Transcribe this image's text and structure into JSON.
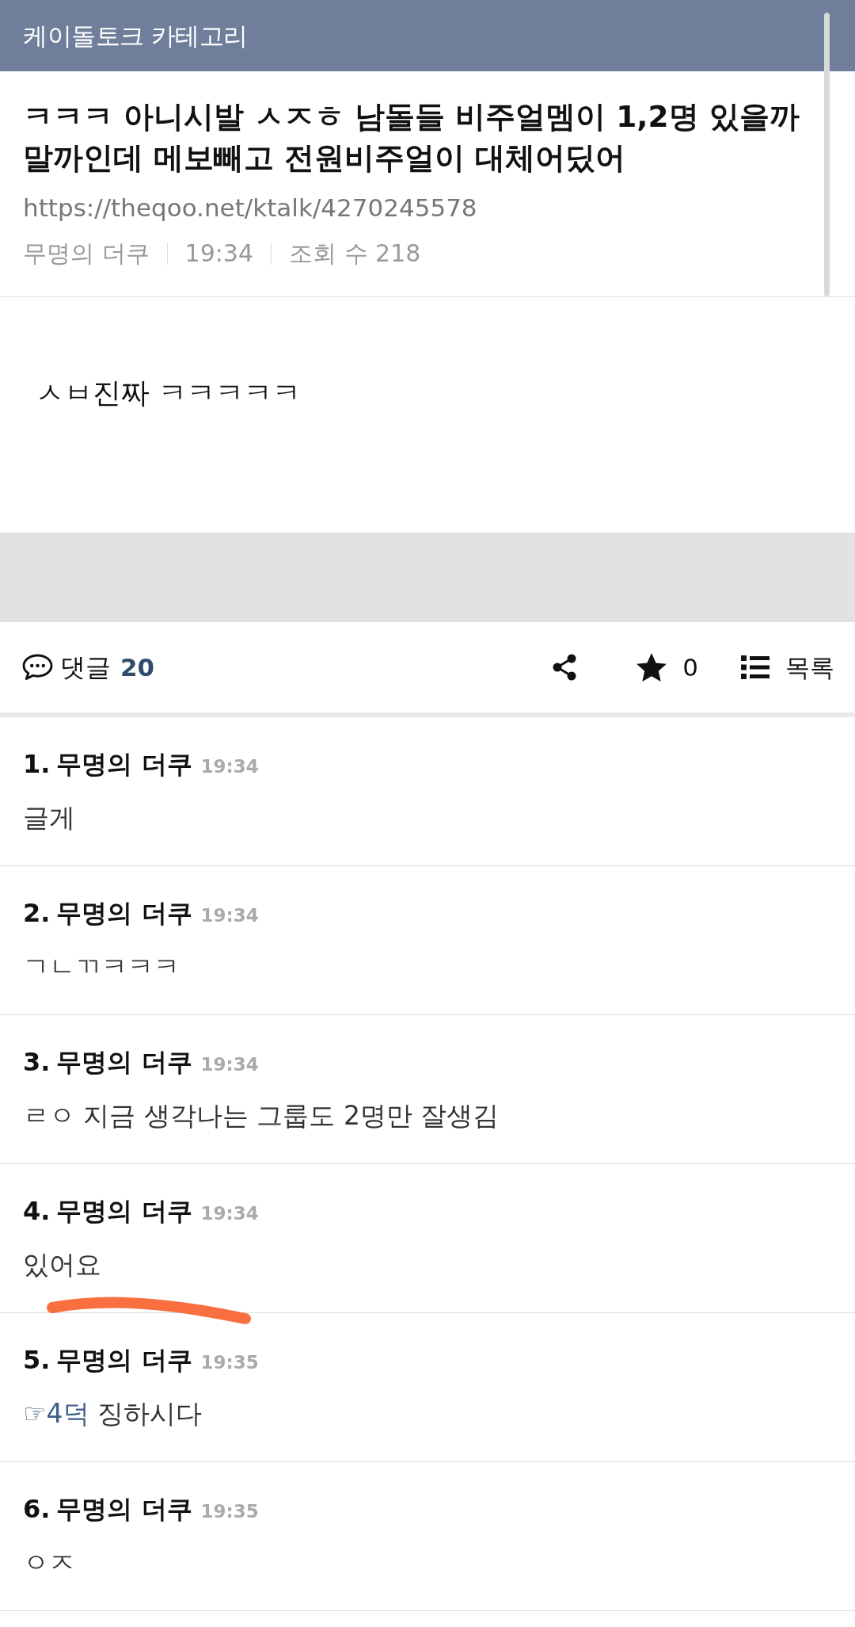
{
  "header": {
    "title": "케이돌토크 카테고리"
  },
  "post": {
    "title": "ㅋㅋㅋ 아니시발 ㅅㅈㅎ 남돌들 비주얼멤이 1,2명 있을까말까인데 메보빼고 전원비주얼이 대체어딨어",
    "url": "https://theqoo.net/ktalk/4270245578",
    "author": "무명의 더쿠",
    "time": "19:34",
    "views": "조회 수 218",
    "body": "ㅅㅂ진짜 ㅋㅋㅋㅋㅋ"
  },
  "comment_bar": {
    "label": "댓글",
    "count": "20",
    "star_count": "0",
    "list_label": "목록"
  },
  "comments": [
    {
      "number": "1.",
      "author": "무명의 더쿠",
      "time": "19:34",
      "text": "글게",
      "marked": false
    },
    {
      "number": "2.",
      "author": "무명의 더쿠",
      "time": "19:34",
      "text": "ㄱㄴㄲㅋㅋㅋ",
      "marked": false
    },
    {
      "number": "3.",
      "author": "무명의 더쿠",
      "time": "19:34",
      "text": "ㄹㅇ 지금 생각나는 그룹도 2명만 잘생김",
      "marked": false
    },
    {
      "number": "4.",
      "author": "무명의 더쿠",
      "time": "19:34",
      "text": "있어요",
      "marked": true
    },
    {
      "number": "5.",
      "author": "무명의 더쿠",
      "time": "19:35",
      "mention": "☞4덕",
      "text": "징하시다",
      "marked": false
    },
    {
      "number": "6.",
      "author": "무명의 더쿠",
      "time": "19:35",
      "text": "ㅇㅈ",
      "marked": false
    }
  ]
}
